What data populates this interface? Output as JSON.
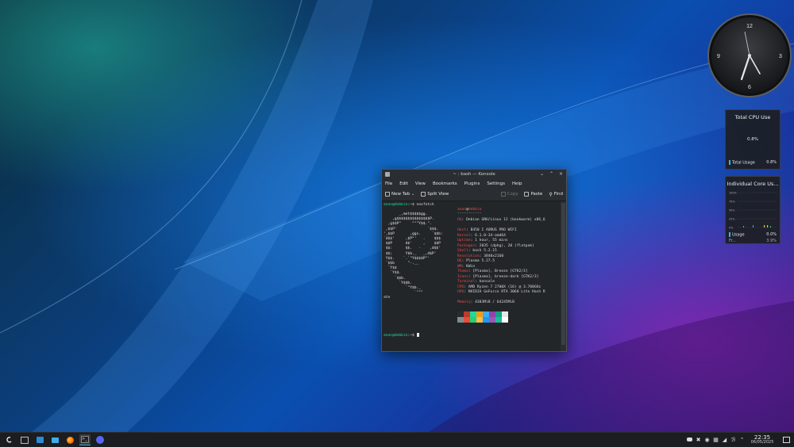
{
  "desktop": {
    "colors": {
      "accent": "#3daee9",
      "prompt": "#1cdc9a",
      "debian_red": "#d33f3f"
    }
  },
  "clock_widget": {
    "numerals": [
      "12",
      "3",
      "6",
      "9"
    ]
  },
  "cpu_total": {
    "title": "Total CPU Use",
    "center_value": "0.8%",
    "legend_label": "Total Usage",
    "legend_value": "0.8%"
  },
  "cpu_cores": {
    "title": "Individual Core Us...",
    "axis": [
      "100%",
      "75%",
      "50%",
      "25%",
      "0%"
    ],
    "usage_label": "Usage",
    "usage_value": "0.0%",
    "cutoff_label": "Fr...",
    "cutoff_value": "3.9%"
  },
  "konsole": {
    "title": "~ : bash — Konsole",
    "menu": [
      "File",
      "Edit",
      "View",
      "Bookmarks",
      "Plugins",
      "Settings",
      "Help"
    ],
    "toolbar": {
      "new_tab": "New Tab",
      "split_view": "Split View",
      "copy": "Copy",
      "paste": "Paste",
      "find": "Find"
    },
    "prompt_user": "anon@debbie",
    "prompt_suffix": ":~$ ",
    "command": "neofetch",
    "logo": [
      "       _,met$$$$$gg.",
      "    ,g$$$$$$$$$$$$$$$P.",
      "  ,g$$P\"     \"\"\"Y$$.\".",
      " ,$$P'              `$$$.",
      "',$$P       ,ggs.     `$$b:",
      "`d$$'     ,$P\"'   .    $$$",
      " $$P      d$'     ,    $$P",
      " $$:      $$.   -    ,d$$'",
      " $$;      Y$b._   _,d$P'",
      " Y$$.    `.`\"Y$$$$P\"'",
      " `$$b      \"-.__",
      "  `Y$$",
      "   `Y$$.",
      "     `$$b.",
      "       `Y$$b.",
      "          `\"Y$b._",
      "              `\"\"\""
    ],
    "info_user": "anon",
    "info_host": "debbie",
    "info_sep": "-----------",
    "info": [
      {
        "k": "OS",
        "v": "Debian GNU/Linux 12 (bookworm) x86_6"
      },
      {
        "k": "Host",
        "v": "B450 I AORUS PRO WIFI"
      },
      {
        "k": "Kernel",
        "v": "6.1.0-34-amd64"
      },
      {
        "k": "Uptime",
        "v": "1 hour, 55 mins"
      },
      {
        "k": "Packages",
        "v": "2035 (dpkg), 20 (flatpak)"
      },
      {
        "k": "Shell",
        "v": "bash 5.2.15"
      },
      {
        "k": "Resolution",
        "v": "3840x2160"
      },
      {
        "k": "DE",
        "v": "Plasma 5.27.5"
      },
      {
        "k": "WM",
        "v": "KWin"
      },
      {
        "k": "Theme",
        "v": "[Plasma], Breeze [GTK2/3]"
      },
      {
        "k": "Icons",
        "v": "[Plasma], breeze-dark [GTK2/3]"
      },
      {
        "k": "Terminal",
        "v": "konsole"
      },
      {
        "k": "CPU",
        "v": "AMD Ryzen 7 2700X (16) @ 3.700GHz"
      },
      {
        "k": "GPU",
        "v": "NVIDIA GeForce RTX 3060 Lite Hash R"
      },
      {
        "k": "Memory",
        "v": "4383MiB / 64245MiB"
      }
    ],
    "wrap_text": "ate",
    "palette_top": [
      "#2b2b2b",
      "#c0392b",
      "#1cdc9a",
      "#f39c12",
      "#3daee9",
      "#8e44ad",
      "#16a085",
      "#e6e6e6"
    ],
    "palette_bottom": [
      "#7f8c8d",
      "#e74c3c",
      "#2ecc71",
      "#fdbc4b",
      "#1d99f3",
      "#9b59b6",
      "#1abc9c",
      "#ffffff"
    ]
  },
  "taskbar": {
    "launcher_icon": "debian-swirl-icon",
    "apps": [
      "system-settings-icon",
      "discover-icon",
      "dolphin-folder-icon",
      "firefox-icon",
      "konsole-icon",
      "discord-icon"
    ],
    "tray": [
      "discord-tray-icon",
      "tools-icon",
      "network-icon",
      "clipboard-icon",
      "volume-icon",
      "bluetooth-icon",
      "expand-tray-icon"
    ],
    "time": "22:35",
    "date": "06/05/2025"
  }
}
